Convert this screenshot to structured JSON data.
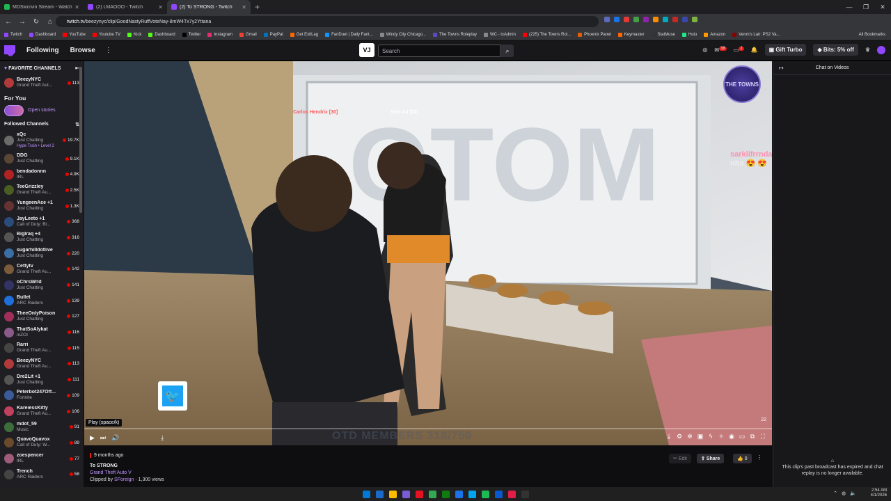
{
  "browser": {
    "tabs": [
      {
        "title": "MDSwcrvin Stream - Watch Liv",
        "color": "#1db954",
        "active": false
      },
      {
        "title": "(2) LMAOOO - Twitch",
        "color": "#9147ff",
        "active": false
      },
      {
        "title": "(2) To STRONG - Twitch",
        "color": "#9147ff",
        "active": true
      }
    ],
    "new_tab": "+",
    "url_host": "twitch.tv",
    "url_path": "/beezynyc/clip/GoodNastyRuffVoteNay-8mW4Tx7y2Yttana",
    "bookmarks": [
      {
        "label": "Twitch",
        "color": "#9147ff"
      },
      {
        "label": "Dashboard",
        "color": "#9147ff"
      },
      {
        "label": "YouTube",
        "color": "#ff0000"
      },
      {
        "label": "Youtube TV",
        "color": "#ff0000"
      },
      {
        "label": "Kick",
        "color": "#53fc18"
      },
      {
        "label": "Dashboard",
        "color": "#53fc18"
      },
      {
        "label": "Twitter",
        "color": "#000000"
      },
      {
        "label": "Instagram",
        "color": "#e1306c"
      },
      {
        "label": "Gmail",
        "color": "#ea4335"
      },
      {
        "label": "PayPal",
        "color": "#0070ba"
      },
      {
        "label": "Get ExitLag",
        "color": "#ff6600"
      },
      {
        "label": "FanDuel | Daily Fant...",
        "color": "#1493ff"
      },
      {
        "label": "Windy City Chicago...",
        "color": "#888888"
      },
      {
        "label": "The Towns Roleplay",
        "color": "#5c4bbf"
      },
      {
        "label": "WC - txAdmin",
        "color": "#888888"
      },
      {
        "label": "(225) The Towns Rol...",
        "color": "#ff0000"
      },
      {
        "label": "Phoenix Panel",
        "color": "#e65c00"
      },
      {
        "label": "Keymaster",
        "color": "#ff6600"
      },
      {
        "label": "StatMuse",
        "color": "#333333"
      },
      {
        "label": "Hulu",
        "color": "#1ce783"
      },
      {
        "label": "Amazon",
        "color": "#ff9900"
      },
      {
        "label": "Venm's Lair: PS2 Va...",
        "color": "#880000"
      }
    ],
    "all_bookmarks": "All Bookmarks"
  },
  "twitch_nav": {
    "following": "Following",
    "browse": "Browse",
    "search_placeholder": "Search",
    "gift_turbo": "Gift Turbo",
    "bits": "Bits: 5% off",
    "notif_count_1": "38",
    "notif_count_2": "2"
  },
  "sidebar": {
    "favorite_header": "FAVORITE CHANNELS",
    "favorites": [
      {
        "name": "BeezyNYC",
        "game": "Grand Theft Aut...",
        "viewers": "113",
        "color": "#b33a3a"
      }
    ],
    "for_you": "For You",
    "open_stories": "Open stories",
    "followed_header": "Followed Channels",
    "channels": [
      {
        "name": "xQc",
        "game": "Just Chatting",
        "viewers": "19.7K",
        "hype": "Hype Train • Level 2",
        "color": "#6b6b6b"
      },
      {
        "name": "DDG",
        "game": "Just Chatting",
        "viewers": "9.1K",
        "color": "#5a4636"
      },
      {
        "name": "bendadonnn",
        "game": "IRL",
        "viewers": "4.9K",
        "color": "#b22222"
      },
      {
        "name": "TeeGrizzley",
        "game": "Grand Theft Au...",
        "viewers": "2.5K",
        "color": "#4a5d23"
      },
      {
        "name": "YungeenAce +1",
        "game": "Just Chatting",
        "viewers": "1.3K",
        "color": "#663333"
      },
      {
        "name": "JayLeeto +1",
        "game": "Call of Duty: Bl...",
        "viewers": "368",
        "color": "#2b4b7a"
      },
      {
        "name": "BigIraq +4",
        "game": "Just Chatting",
        "viewers": "316",
        "color": "#555555"
      },
      {
        "name": "sugarhilldotlive",
        "game": "Just Chatting",
        "viewers": "220",
        "color": "#3a6ea5"
      },
      {
        "name": "Cettytv",
        "game": "Grand Theft Au...",
        "viewers": "142",
        "color": "#7a5c3a"
      },
      {
        "name": "oChrsWrld",
        "game": "Just Chatting",
        "viewers": "141",
        "color": "#333366"
      },
      {
        "name": "Bullet",
        "game": "ARC Raiders",
        "viewers": "139",
        "color": "#1e6fd9"
      },
      {
        "name": "TheeOnlyPoison",
        "game": "Just Chatting",
        "viewers": "127",
        "color": "#a0305a"
      },
      {
        "name": "ThatSoAlykat",
        "game": "inZOI",
        "viewers": "116",
        "color": "#8a5a8a"
      },
      {
        "name": "Rarri",
        "game": "Grand Theft Au...",
        "viewers": "115",
        "color": "#444444"
      },
      {
        "name": "BeezyNYC",
        "game": "Grand Theft Au...",
        "viewers": "113",
        "color": "#b33a3a"
      },
      {
        "name": "Dre2Lit +1",
        "game": "Just Chatting",
        "viewers": "111",
        "color": "#555555"
      },
      {
        "name": "Peterbot247Off...",
        "game": "Fortnite",
        "viewers": "109",
        "color": "#3a5a9a"
      },
      {
        "name": "KareiessKitty",
        "game": "Grand Theft Au...",
        "viewers": "106",
        "color": "#c04060"
      },
      {
        "name": "mdot_59",
        "game": "Music",
        "viewers": "91",
        "color": "#3c6e3c"
      },
      {
        "name": "QuavoQuavox",
        "game": "Call of Duty: W...",
        "viewers": "89",
        "color": "#6a4a2a"
      },
      {
        "name": "zoespencer",
        "game": "IRL",
        "viewers": "77",
        "color": "#a05a7a"
      },
      {
        "name": "Trench",
        "game": "ARC Raiders",
        "viewers": "58",
        "color": "#444444"
      }
    ]
  },
  "player": {
    "name_tag_1": "Carlos Hendrix [30]",
    "name_tag_2": "Sebi Ali [02]",
    "towns_logo": "THE TOWNS",
    "chat_user": "sarkiifrrndarich",
    "chat_text": ": nbs 😍 😍",
    "tooltip": "Play (space/k)",
    "watermark": "OTD MEMBERS 318/750",
    "counter": "22",
    "progress_fraction": 0.0
  },
  "clip_info": {
    "ago": "9 months ago",
    "title": "To STRONG",
    "game": "Grand Theft Auto V",
    "clipped_by_prefix": "Clipped by",
    "clipper": "SForeign",
    "views": " · 1,300 views",
    "edit": "Edit",
    "share": "Share",
    "likes": "0"
  },
  "chat": {
    "header": "Chat on Videos",
    "expired": "This clip's past broadcast has expired and chat replay is no longer available."
  },
  "taskbar": {
    "time": "2:54 AM",
    "date": "4/1/2026",
    "apps": [
      "#0078d4",
      "#1b6ac9",
      "#ffb900",
      "#7b5cd6",
      "#e81123",
      "#34a853",
      "#107c10",
      "#1a73e8",
      "#00a4ef",
      "#1db954",
      "#0b57d0",
      "#e11d48",
      "#333333"
    ]
  }
}
